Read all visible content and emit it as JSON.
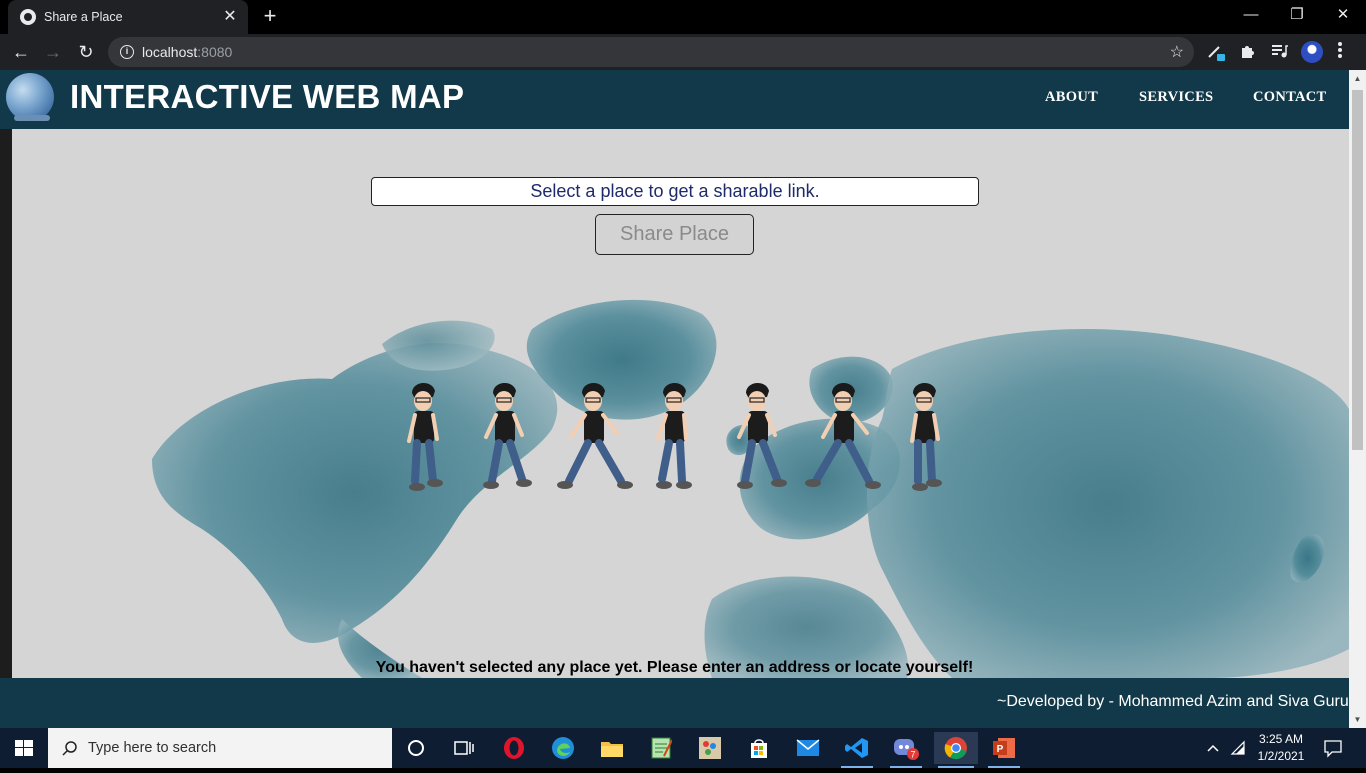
{
  "browser": {
    "tab_title": "Share a Place",
    "tab_close": "✕",
    "new_tab": "+",
    "url_host": "localhost",
    "url_port": ":8080",
    "window_controls": {
      "minimize": "—",
      "restore": "❐",
      "close": "✕"
    }
  },
  "site": {
    "title": "INTERACTIVE WEB MAP",
    "nav": [
      "ABOUT",
      "SERVICES",
      "CONTACT"
    ],
    "address_input": {
      "value": "Select a place to get a sharable link."
    },
    "share_button": "Share Place",
    "status_message": "You haven't selected any place yet. Please enter an address or locate yourself!",
    "footer": "~Developed by - Mohammed Azim and Siva Guru",
    "walking_characters": 7
  },
  "taskbar": {
    "search_placeholder": "Type here to search",
    "time": "3:25 AM",
    "date": "1/2/2021",
    "discord_badge": "7"
  },
  "colors": {
    "header_bg": "#11394a",
    "map_bg": "#d5d5d6",
    "map_land": "#3e7d8c",
    "input_text": "#1f2a6b"
  }
}
